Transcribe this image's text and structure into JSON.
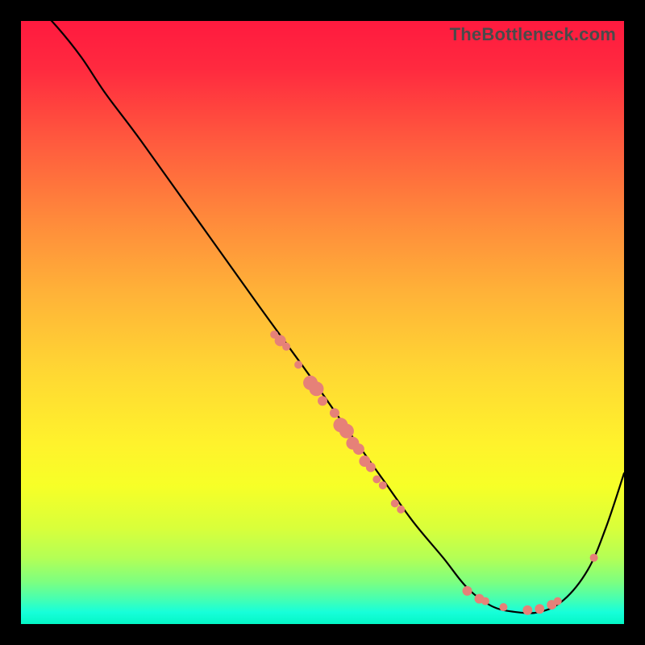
{
  "watermark": "TheBottleneck.com",
  "colors": {
    "gradient_top": "#ff1a3f",
    "gradient_mid": "#ffd733",
    "gradient_bottom": "#04f7c6",
    "curve": "#000000",
    "dot": "#e68178",
    "frame_bg": "#000000"
  },
  "chart_data": {
    "type": "line",
    "title": "",
    "xlabel": "",
    "ylabel": "",
    "xlim": [
      0,
      100
    ],
    "ylim": [
      0,
      100
    ],
    "series": [
      {
        "name": "bottleneck-curve",
        "x": [
          0,
          3,
          6,
          10,
          14,
          20,
          30,
          40,
          48,
          55,
          60,
          65,
          70,
          74,
          78,
          82,
          86,
          90,
          94,
          97,
          100
        ],
        "y": [
          104,
          102,
          99,
          94,
          88,
          80,
          66,
          52,
          41,
          31,
          24,
          17,
          11,
          6,
          3,
          2,
          2,
          4,
          9,
          16,
          25
        ]
      }
    ],
    "scatter": [
      {
        "name": "cluster-upper",
        "points": [
          {
            "x": 42,
            "y": 48,
            "r": 5
          },
          {
            "x": 43,
            "y": 47,
            "r": 7
          },
          {
            "x": 44,
            "y": 46,
            "r": 5
          },
          {
            "x": 46,
            "y": 43,
            "r": 5
          },
          {
            "x": 48,
            "y": 40,
            "r": 9
          },
          {
            "x": 49,
            "y": 39,
            "r": 9
          },
          {
            "x": 50,
            "y": 37,
            "r": 6
          },
          {
            "x": 52,
            "y": 35,
            "r": 6
          },
          {
            "x": 53,
            "y": 33,
            "r": 9
          },
          {
            "x": 54,
            "y": 32,
            "r": 9
          },
          {
            "x": 55,
            "y": 30,
            "r": 8
          },
          {
            "x": 56,
            "y": 29,
            "r": 7
          },
          {
            "x": 57,
            "y": 27,
            "r": 7
          },
          {
            "x": 58,
            "y": 26,
            "r": 6
          },
          {
            "x": 59,
            "y": 24,
            "r": 5
          },
          {
            "x": 60,
            "y": 23,
            "r": 5
          },
          {
            "x": 62,
            "y": 20,
            "r": 5
          },
          {
            "x": 63,
            "y": 19,
            "r": 5
          }
        ]
      },
      {
        "name": "cluster-bottom",
        "points": [
          {
            "x": 74,
            "y": 5.5,
            "r": 6
          },
          {
            "x": 76,
            "y": 4.2,
            "r": 6
          },
          {
            "x": 77,
            "y": 3.8,
            "r": 5
          },
          {
            "x": 80,
            "y": 2.8,
            "r": 5
          },
          {
            "x": 84,
            "y": 2.3,
            "r": 6
          },
          {
            "x": 86,
            "y": 2.5,
            "r": 6
          },
          {
            "x": 88,
            "y": 3.2,
            "r": 6
          },
          {
            "x": 89,
            "y": 3.8,
            "r": 5
          }
        ]
      },
      {
        "name": "outlier-right",
        "points": [
          {
            "x": 95,
            "y": 11,
            "r": 5
          }
        ]
      }
    ]
  }
}
